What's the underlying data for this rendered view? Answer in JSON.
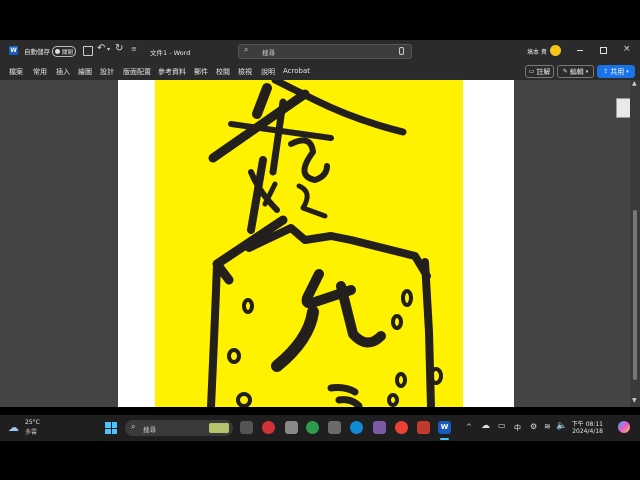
{
  "titlebar": {
    "autosave_label": "自動儲存",
    "autosave_state": "關閉",
    "doc_title": "文件1 - Word",
    "search_placeholder": "搜尋",
    "user_name": "塙本 貴"
  },
  "ribbon": {
    "tabs": [
      "檔案",
      "常用",
      "插入",
      "繪圖",
      "設計",
      "版面配置",
      "參考資料",
      "郵件",
      "校閱",
      "檢視",
      "說明",
      "Acrobat"
    ],
    "comments_label": "註解",
    "editing_label": "編輯",
    "share_label": "共用"
  },
  "document": {
    "calligraphy_chars": [
      "奉",
      "勅",
      "令",
      "九"
    ]
  },
  "taskbar": {
    "weather_temp": "25°C",
    "weather_desc": "多雲",
    "search_placeholder": "搜尋",
    "ime": "中",
    "time": "下午 08:11",
    "date": "2024/4/18"
  },
  "colors": {
    "talisman_yellow": "#FFF200",
    "ink": "#231f1c",
    "word_blue": "#185abd",
    "share_blue": "#1a73e8"
  }
}
